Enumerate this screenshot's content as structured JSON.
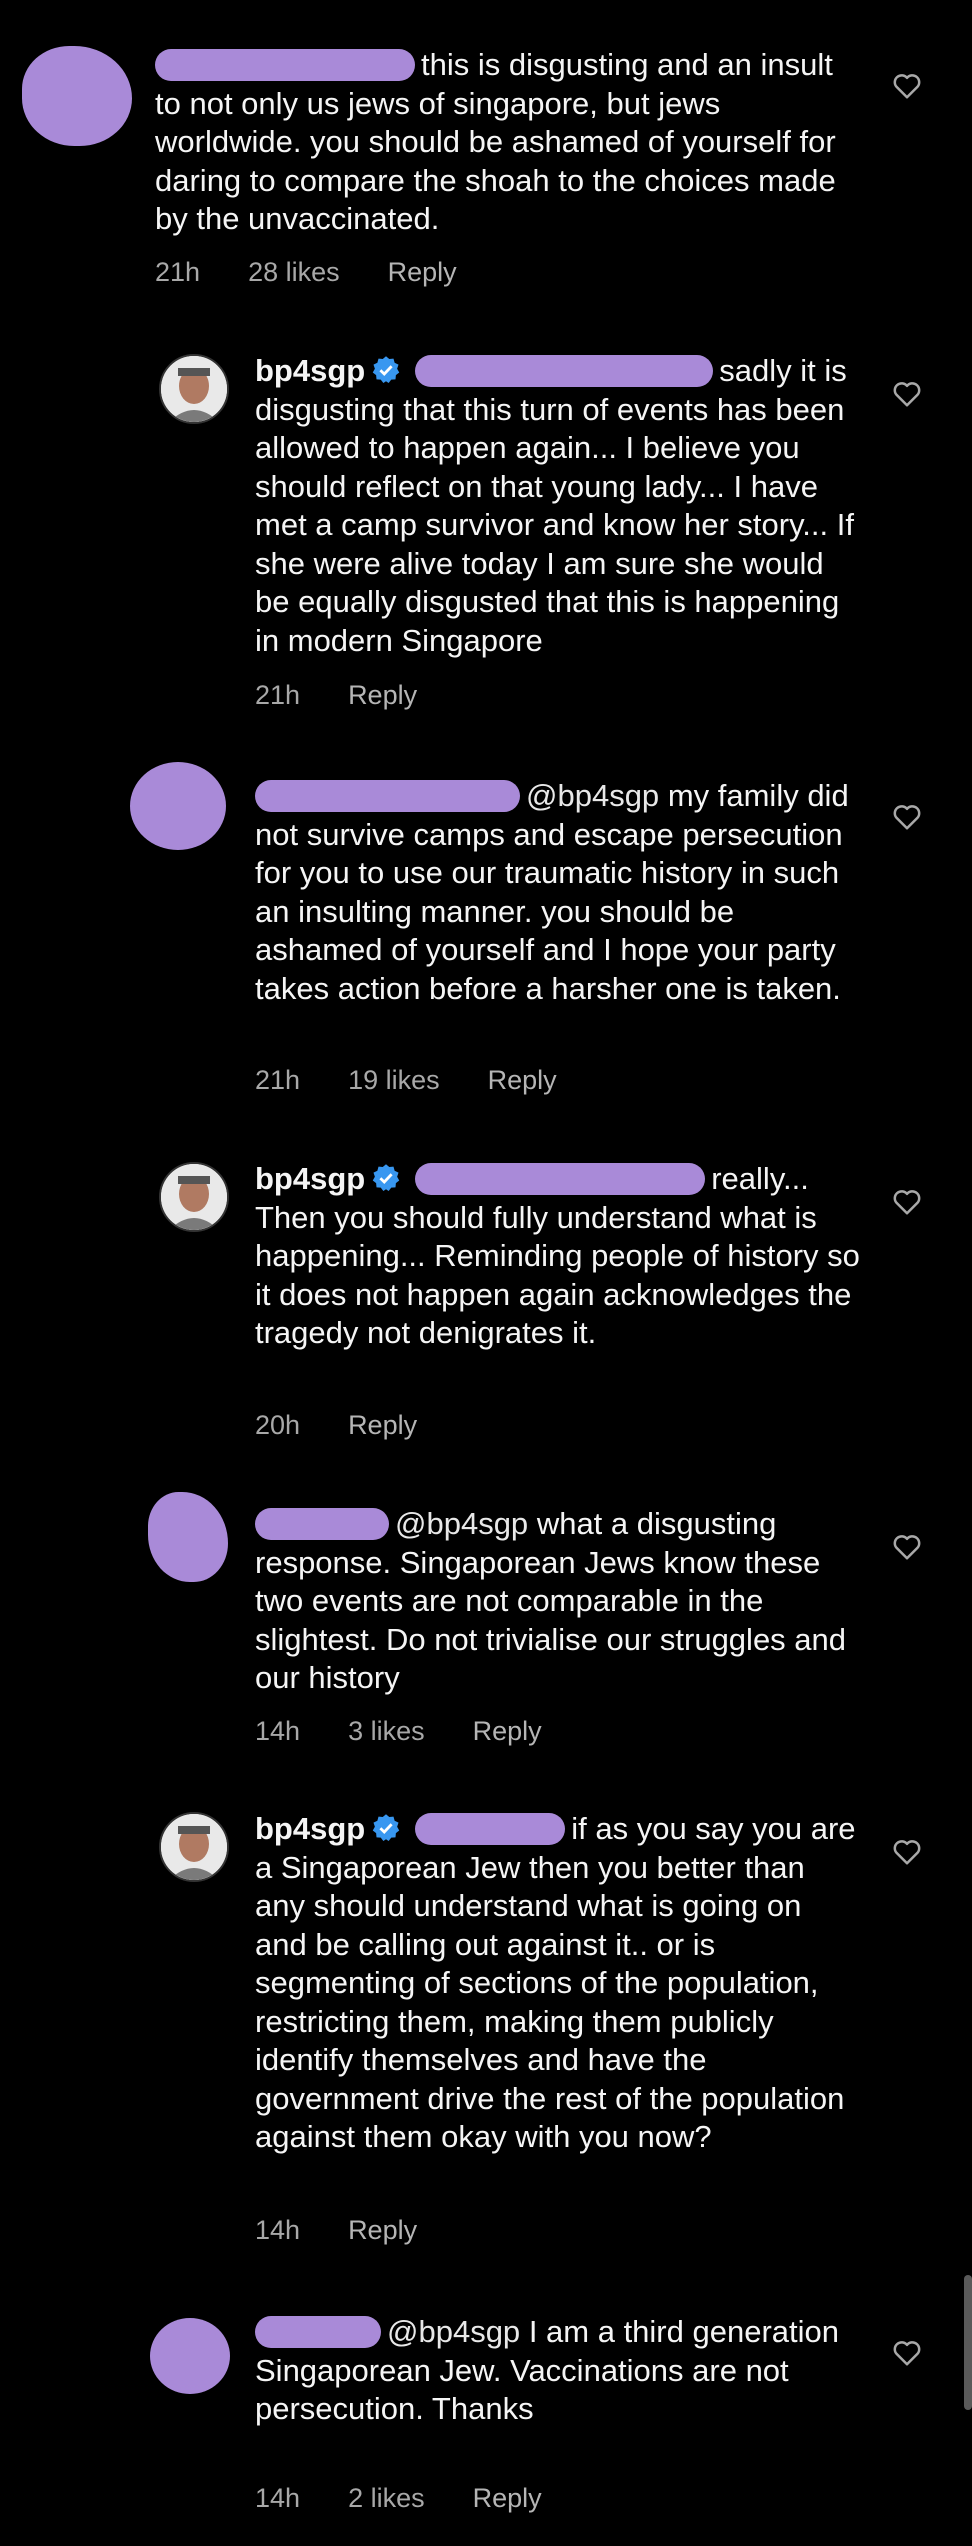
{
  "comments": [
    {
      "avatar": "redacted",
      "username": "",
      "text": "this is disgusting and an insult to not only us jews of singapore, but jews worldwide. you should be ashamed of yourself for daring to compare the shoah to the choices made by the unvaccinated.",
      "time": "21h",
      "likes": "28 likes",
      "reply": "Reply"
    },
    {
      "avatar": "photo",
      "username": "bp4sgp",
      "verified": true,
      "text": "sadly it is disgusting that this turn of events has been allowed to happen again... I believe you should reflect on that young lady... I have met a camp survivor and know her story... If she were alive today I am sure she would be equally disgusted that this is happening in modern Singapore",
      "time": "21h",
      "likes": "",
      "reply": "Reply"
    },
    {
      "avatar": "redacted",
      "username": "",
      "mention": "@bp4sgp",
      "text": "my family did not survive camps and escape persecution for you to use our traumatic history in such an insulting manner. you should be ashamed of yourself and I hope your party takes action before a harsher one is taken.",
      "time": "21h",
      "likes": "19 likes",
      "reply": "Reply"
    },
    {
      "avatar": "photo",
      "username": "bp4sgp",
      "verified": true,
      "text": "really... Then you should fully understand what is happening... Reminding people of history so it does not happen again acknowledges the tragedy not denigrates it.",
      "time": "20h",
      "likes": "",
      "reply": "Reply"
    },
    {
      "avatar": "redacted",
      "username": "",
      "mention": "@bp4sgp",
      "text": "what a disgusting response. Singaporean Jews know these two events are not comparable in the slightest. Do not trivialise our struggles and our history",
      "time": "14h",
      "likes": "3 likes",
      "reply": "Reply"
    },
    {
      "avatar": "photo",
      "username": "bp4sgp",
      "verified": true,
      "text": "if as you say you are a Singaporean Jew then you better than any should understand what is going on and be calling out against it.. or is segmenting of sections of the population, restricting them, making them publicly identify themselves and have the government drive the rest of the population against them okay with you now?",
      "time": "14h",
      "likes": "",
      "reply": "Reply"
    },
    {
      "avatar": "redacted",
      "username": "",
      "mention": "@bp4sgp",
      "text": "I am a third generation Singaporean Jew. Vaccinations are not persecution. Thanks",
      "time": "14h",
      "likes": "2 likes",
      "reply": "Reply"
    }
  ],
  "colors": {
    "background": "#000000",
    "text": "#f5f5f5",
    "meta": "#a8a8a8",
    "redaction": "#a98ad8",
    "verified": "#3897f0"
  },
  "icons": {
    "like": "heart-outline-icon",
    "verified": "verified-badge-icon"
  }
}
